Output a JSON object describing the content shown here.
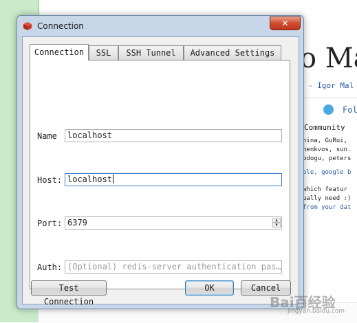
{
  "background": {
    "page_title": "o Ma",
    "author_line": "- Igor Mal",
    "follow_text": "Fol",
    "community_heading": "Community",
    "lines": [
      {
        "text": "hina, GuRui,",
        "color": "black"
      },
      {
        "text": "henkvos, sun.",
        "color": "black"
      },
      {
        "text": "odogu, peters",
        "color": "black"
      },
      {
        "text": "ole, google b",
        "color": "blue"
      },
      {
        "text": "which featur",
        "color": "black"
      },
      {
        "text": "ually need :)",
        "color": "black"
      },
      {
        "text": "from your dat",
        "color": "blue"
      }
    ]
  },
  "window": {
    "title": "Connection",
    "close_glyph": "✕",
    "tabs": [
      {
        "label": "Connection",
        "active": true
      },
      {
        "label": "SSL",
        "active": false
      },
      {
        "label": "SSH Tunnel",
        "active": false
      },
      {
        "label": "Advanced Settings",
        "active": false
      }
    ],
    "form": {
      "name_label": "Name",
      "name_value": "localhost",
      "host_label": "Host:",
      "host_value": "localhost",
      "port_label": "Port:",
      "port_value": "6379",
      "auth_label": "Auth:",
      "auth_placeholder": "(Optional) redis-server authentication pas…"
    },
    "buttons": {
      "test_connection": "Test Connection",
      "ok": "OK",
      "cancel": "Cancel"
    }
  },
  "watermark": {
    "text": "Bai百经验",
    "sub": "jingyan.baidu.com"
  },
  "colors": {
    "accent_focus": "#3d7bc9",
    "close_red": "#c0381d",
    "link_blue": "#2b5aa8"
  }
}
